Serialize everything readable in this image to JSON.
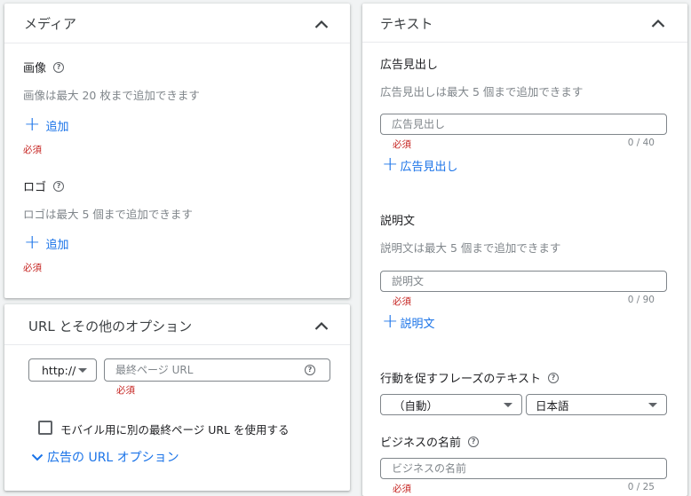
{
  "media": {
    "title": "メディア",
    "image": {
      "label": "画像",
      "hint": "画像は最大 20 枚まで追加できます",
      "add_label": "追加",
      "required": "必須"
    },
    "logo": {
      "label": "ロゴ",
      "hint": "ロゴは最大 5 個まで追加できます",
      "add_label": "追加",
      "required": "必須"
    }
  },
  "url_options": {
    "title": "URL とその他のオプション",
    "protocol": "http://",
    "final_url_placeholder": "最終ページ URL",
    "required": "必須",
    "mobile_checkbox_label": "モバイル用に別の最終ページ URL を使用する",
    "ad_url_options_label": "広告の URL オプション"
  },
  "text": {
    "title": "テキスト",
    "headline": {
      "label": "広告見出し",
      "hint": "広告見出しは最大 5 個まで追加できます",
      "placeholder": "広告見出し",
      "required": "必須",
      "counter": "0 / 40",
      "add_label": "広告見出し"
    },
    "description": {
      "label": "説明文",
      "hint": "説明文は最大 5 個まで追加できます",
      "placeholder": "説明文",
      "required": "必須",
      "counter": "0 / 90",
      "add_label": "説明文"
    },
    "cta": {
      "label": "行動を促すフレーズのテキスト",
      "option_value": "（自動）",
      "language_value": "日本語"
    },
    "business_name": {
      "label": "ビジネスの名前",
      "placeholder": "ビジネスの名前",
      "required": "必須",
      "counter": "0 / 25"
    }
  },
  "colors": {
    "accent": "#1a73e8",
    "required": "#c5221f",
    "hint": "#80868b"
  }
}
